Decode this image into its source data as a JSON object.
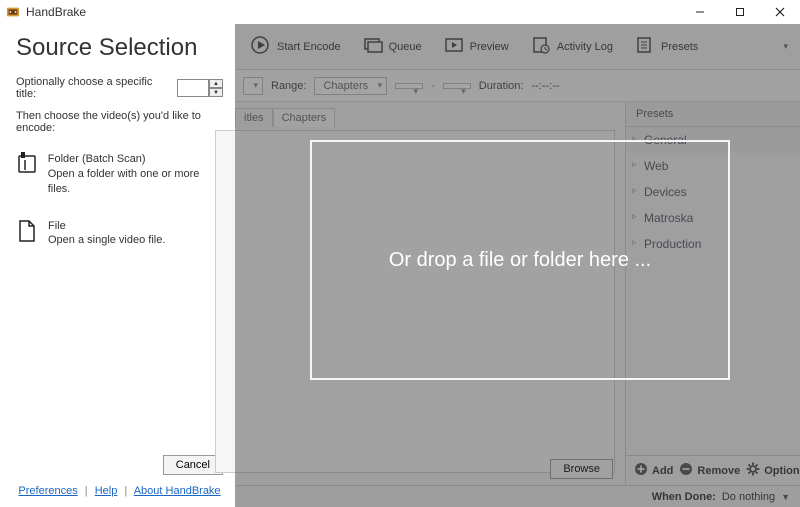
{
  "window": {
    "title": "HandBrake"
  },
  "source_panel": {
    "heading": "Source Selection",
    "optional_label": "Optionally choose a specific title:",
    "title_spinner_value": "",
    "instruction": "Then choose the video(s) you'd like to encode:",
    "folder_option": {
      "title": "Folder (Batch Scan)",
      "desc": "Open a folder with one or more files."
    },
    "file_option": {
      "title": "File",
      "desc": "Open a single video file."
    },
    "cancel": "Cancel",
    "links": {
      "preferences": "Preferences",
      "help": "Help",
      "about": "About HandBrake"
    }
  },
  "toolbar": {
    "start_encode": "Start Encode",
    "queue": "Queue",
    "preview": "Preview",
    "activity_log": "Activity Log",
    "presets": "Presets"
  },
  "controls": {
    "range_label": "Range:",
    "range_value": "Chapters",
    "range_from": "",
    "range_to": "",
    "duration_label": "Duration:",
    "duration_value": "--:--:--"
  },
  "tabs": {
    "titles": "itles",
    "chapters": "Chapters"
  },
  "browse": "Browse",
  "presets_panel": {
    "header": "Presets",
    "items": [
      "General",
      "Web",
      "Devices",
      "Matroska",
      "Production"
    ],
    "add": "Add",
    "remove": "Remove",
    "options": "Options"
  },
  "status_bar": {
    "when_done_label": "When Done:",
    "when_done_value": "Do nothing"
  },
  "dropzone": {
    "text": "Or drop a file or folder here ..."
  }
}
